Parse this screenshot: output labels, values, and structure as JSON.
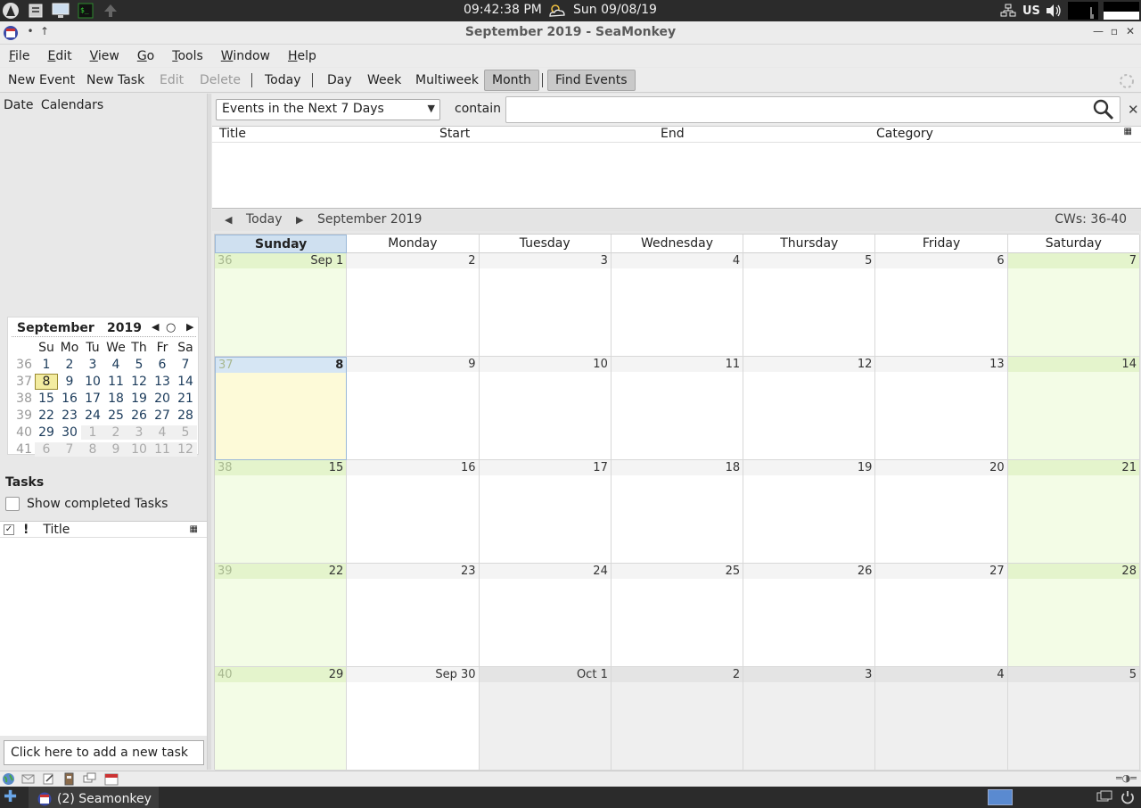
{
  "system": {
    "clock": "09:42:38 PM",
    "date": "Sun 09/08/19",
    "keyboard": "US"
  },
  "window": {
    "title": "September 2019 - SeaMonkey"
  },
  "menubar": {
    "items": [
      {
        "pre": "",
        "ul": "F",
        "post": "ile"
      },
      {
        "pre": "",
        "ul": "E",
        "post": "dit"
      },
      {
        "pre": "",
        "ul": "V",
        "post": "iew"
      },
      {
        "pre": "",
        "ul": "G",
        "post": "o"
      },
      {
        "pre": "",
        "ul": "T",
        "post": "ools"
      },
      {
        "pre": "",
        "ul": "W",
        "post": "indow"
      },
      {
        "pre": "",
        "ul": "H",
        "post": "elp"
      }
    ]
  },
  "toolbar": {
    "new_event": "New Event",
    "new_task": "New Task",
    "edit": "Edit",
    "delete": "Delete",
    "today": "Today",
    "day": "Day",
    "week": "Week",
    "multiweek": "Multiweek",
    "month": "Month",
    "find_events": "Find Events"
  },
  "left": {
    "tab_date": "Date",
    "tab_calendars": "Calendars",
    "minical": {
      "month": "September",
      "year": "2019",
      "weekdays": [
        "Su",
        "Mo",
        "Tu",
        "We",
        "Th",
        "Fr",
        "Sa"
      ],
      "weeks": [
        {
          "wk": "36",
          "days": [
            "1",
            "2",
            "3",
            "4",
            "5",
            "6",
            "7"
          ]
        },
        {
          "wk": "37",
          "days": [
            "8",
            "9",
            "10",
            "11",
            "12",
            "13",
            "14"
          ]
        },
        {
          "wk": "38",
          "days": [
            "15",
            "16",
            "17",
            "18",
            "19",
            "20",
            "21"
          ]
        },
        {
          "wk": "39",
          "days": [
            "22",
            "23",
            "24",
            "25",
            "26",
            "27",
            "28"
          ]
        },
        {
          "wk": "40",
          "days": [
            "29",
            "30",
            "1",
            "2",
            "3",
            "4",
            "5"
          ]
        },
        {
          "wk": "41",
          "days": [
            "6",
            "7",
            "8",
            "9",
            "10",
            "11",
            "12"
          ]
        }
      ]
    },
    "tasks_title": "Tasks",
    "show_completed": "Show completed Tasks",
    "task_col_title": "Title",
    "task_col_priority": "!",
    "add_task_placeholder": "Click here to add a new task"
  },
  "search": {
    "filter": "Events in the Next 7 Days",
    "contain": "contain",
    "value": ""
  },
  "events_columns": [
    "Title",
    "Start",
    "End",
    "Category"
  ],
  "month_nav": {
    "today": "Today",
    "label": "September 2019",
    "cws": "CWs: 36-40"
  },
  "month": {
    "dayheaders": [
      "Sunday",
      "Monday",
      "Tuesday",
      "Wednesday",
      "Thursday",
      "Friday",
      "Saturday"
    ],
    "weeks": [
      {
        "wk": "36",
        "days": [
          "Sep 1",
          "2",
          "3",
          "4",
          "5",
          "6",
          "7"
        ]
      },
      {
        "wk": "37",
        "days": [
          "8",
          "9",
          "10",
          "11",
          "12",
          "13",
          "14"
        ]
      },
      {
        "wk": "38",
        "days": [
          "15",
          "16",
          "17",
          "18",
          "19",
          "20",
          "21"
        ]
      },
      {
        "wk": "39",
        "days": [
          "22",
          "23",
          "24",
          "25",
          "26",
          "27",
          "28"
        ]
      },
      {
        "wk": "40",
        "days": [
          "29",
          "Sep 30",
          "Oct 1",
          "2",
          "3",
          "4",
          "5"
        ]
      }
    ]
  },
  "taskbar": {
    "app_label": "(2) Seamonkey"
  },
  "colors": {
    "weekend": "#f3fce6",
    "today": "#fdfad8",
    "selected_header": "#cfe0f0"
  }
}
